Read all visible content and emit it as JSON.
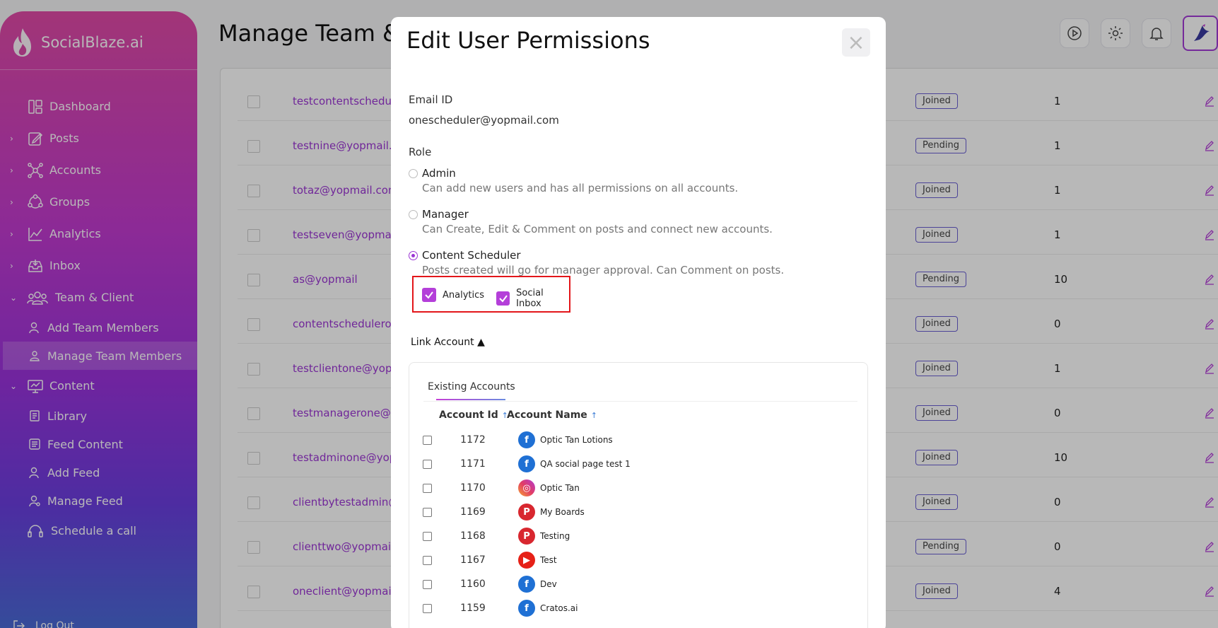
{
  "app": {
    "name": "SocialBlaze.ai",
    "page_title": "Manage Team &"
  },
  "sidebar": {
    "items": [
      {
        "label": "Dashboard",
        "icon": "dashboard-icon",
        "chevron": ""
      },
      {
        "label": "Posts",
        "icon": "posts-icon",
        "chevron": "›"
      },
      {
        "label": "Accounts",
        "icon": "accounts-icon",
        "chevron": "›"
      },
      {
        "label": "Groups",
        "icon": "groups-icon",
        "chevron": "›"
      },
      {
        "label": "Analytics",
        "icon": "analytics-icon",
        "chevron": "›"
      },
      {
        "label": "Inbox",
        "icon": "inbox-icon",
        "chevron": "›"
      },
      {
        "label": "Team & Client",
        "icon": "team-icon",
        "chevron": "⌄"
      }
    ],
    "team_sub": [
      {
        "label": "Add Team Members"
      },
      {
        "label": "Manage Team Members"
      }
    ],
    "content": {
      "label": "Content",
      "chevron": "⌄"
    },
    "content_sub": [
      {
        "label": "Library"
      },
      {
        "label": "Feed Content"
      },
      {
        "label": "Add Feed"
      },
      {
        "label": "Manage Feed"
      }
    ],
    "schedule": {
      "label": "Schedule a call"
    },
    "logout": "Log Out"
  },
  "table": {
    "rows": [
      {
        "email": "testcontentschedule",
        "status": "Joined",
        "count": "1"
      },
      {
        "email": "testnine@yopmail.c",
        "status": "Pending",
        "count": "1"
      },
      {
        "email": "totaz@yopmail.com",
        "status": "Joined",
        "count": "1"
      },
      {
        "email": "testseven@yopmail",
        "status": "Joined",
        "count": "1"
      },
      {
        "email": "as@yopmail",
        "status": "Pending",
        "count": "10"
      },
      {
        "email": "contentscheduleron",
        "status": "Joined",
        "count": "0"
      },
      {
        "email": "testclientone@yopn",
        "status": "Joined",
        "count": "1"
      },
      {
        "email": "testmanagerone@y",
        "status": "Joined",
        "count": "0"
      },
      {
        "email": "testadminone@yop",
        "status": "Joined",
        "count": "10"
      },
      {
        "email": "clientbytestadmin@",
        "status": "Joined",
        "count": "0"
      },
      {
        "email": "clienttwo@yopmail.",
        "status": "Pending",
        "count": "0"
      },
      {
        "email": "oneclient@yopmail.",
        "status": "Joined",
        "count": "4"
      }
    ]
  },
  "modal": {
    "title": "Edit User Permissions",
    "close": "×",
    "email_label": "Email ID",
    "email_value": "onescheduler@yopmail.com",
    "role_label": "Role",
    "roles": [
      {
        "name": "Admin",
        "desc": "Can add new users and has all permissions on all accounts.",
        "selected": false
      },
      {
        "name": "Manager",
        "desc": "Can Create, Edit & Comment on posts and connect new accounts.",
        "selected": false
      },
      {
        "name": "Content Scheduler",
        "desc": "Posts created will go for manager approval. Can Comment on posts.",
        "selected": true
      }
    ],
    "permissions": [
      {
        "label": "Analytics",
        "checked": true
      },
      {
        "label": "Social Inbox",
        "checked": true
      }
    ],
    "link_account": "Link Account ▲",
    "existing_tab": "Existing Accounts",
    "col_id": "Account Id",
    "col_name": "Account Name",
    "sort_arrow": "↑",
    "accounts": [
      {
        "id": "1172",
        "name": "Optic Tan Lotions",
        "type": "facebook"
      },
      {
        "id": "1171",
        "name": "QA social page test 1",
        "type": "facebook"
      },
      {
        "id": "1170",
        "name": "Optic Tan",
        "type": "instagram"
      },
      {
        "id": "1169",
        "name": "My Boards",
        "type": "pinterest"
      },
      {
        "id": "1168",
        "name": "Testing",
        "type": "pinterest"
      },
      {
        "id": "1167",
        "name": "Test",
        "type": "youtube"
      },
      {
        "id": "1160",
        "name": "Dev",
        "type": "facebook"
      },
      {
        "id": "1159",
        "name": "Cratos.ai",
        "type": "facebook"
      }
    ]
  },
  "colors": {
    "accent": "#9b35d4",
    "highlight": "#e3161a"
  }
}
